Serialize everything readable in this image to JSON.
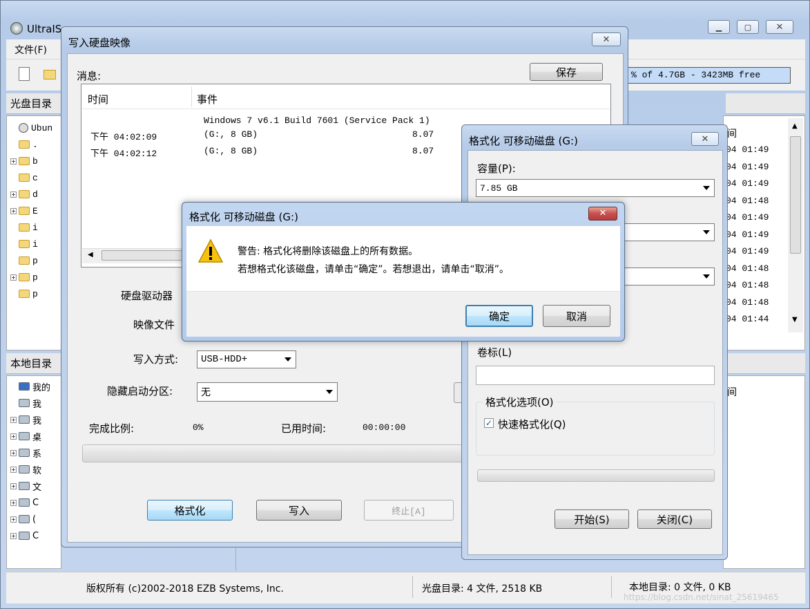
{
  "main": {
    "title": "UltraISO (试用版) - C:\\Users\\Administrator\\Desktop\\ubuntu-14.04.5-desktop-amd64.iso",
    "menu_file": "文件(F)",
    "free_space": "% of 4.7GB - 3423MB free",
    "cd_dir_label": "光盘目录",
    "local_dir_label": "本地目录",
    "cd_tree": [
      {
        "expander": "",
        "label": "Ubun"
      },
      {
        "expander": "",
        "label": "."
      },
      {
        "expander": "+",
        "label": "b"
      },
      {
        "expander": "",
        "label": "c"
      },
      {
        "expander": "+",
        "label": "d"
      },
      {
        "expander": "+",
        "label": "E"
      },
      {
        "expander": "",
        "label": "i"
      },
      {
        "expander": "",
        "label": "i"
      },
      {
        "expander": "",
        "label": "p"
      },
      {
        "expander": "+",
        "label": "p"
      },
      {
        "expander": "",
        "label": "p"
      }
    ],
    "local_tree": [
      {
        "expander": "",
        "label": "我的"
      },
      {
        "expander": "",
        "label": "我"
      },
      {
        "expander": "+",
        "label": "我"
      },
      {
        "expander": "+",
        "label": "桌"
      },
      {
        "expander": "+",
        "label": "系"
      },
      {
        "expander": "+",
        "label": "软"
      },
      {
        "expander": "+",
        "label": "文"
      },
      {
        "expander": "+",
        "label": "C"
      },
      {
        "expander": "+",
        "label": "("
      },
      {
        "expander": "+",
        "label": "C"
      }
    ],
    "right_header": "间",
    "right_times": [
      "04 01:49",
      "04 01:49",
      "04 01:49",
      "04 01:48",
      "04 01:49",
      "04 01:49",
      "04 01:49",
      "04 01:48",
      "04 01:48",
      "04 01:48",
      "04 01:44"
    ],
    "local_right_header": "间",
    "status_copyright": "版权所有 (c)2002-2018 EZB Systems, Inc.",
    "status_cd": "光盘目录: 4 文件, 2518 KB",
    "status_local": "本地目录: 0 文件, 0 KB",
    "watermark": "https://blog.csdn.net/sinat_25619465"
  },
  "write_dialog": {
    "title": "写入硬盘映像",
    "message_label": "消息:",
    "save_button": "保存",
    "columns": [
      "时间",
      "事件"
    ],
    "rows": [
      {
        "time": "",
        "event": "Windows 7 v6.1 Build 7601 (Service Pack 1)",
        "extra": ""
      },
      {
        "time": "下午 04:02:09",
        "event": "(G:, 8 GB)",
        "extra": "8.07"
      },
      {
        "time": "下午 04:02:12",
        "event": "(G:, 8 GB)",
        "extra": "8.07"
      }
    ],
    "drive_label": "硬盘驱动器",
    "image_label": "映像文件",
    "write_mode_label": "写入方式:",
    "write_mode_value": "USB-HDD+",
    "hide_boot_label": "隐藏启动分区:",
    "hide_boot_value": "无",
    "complete_label": "完成比例:",
    "complete_value": "0%",
    "elapsed_label": "已用时间:",
    "elapsed_value": "00:00:00",
    "progress": 0,
    "format_button": "格式化",
    "write_button": "写入",
    "stop_button": "终止[A]"
  },
  "format_dialog": {
    "title": "格式化 可移动磁盘 (G:)",
    "capacity_label": "容量(P):",
    "capacity_value": "7.85 GB",
    "volume_label": "卷标(L)",
    "volume_value": "",
    "options_legend": "格式化选项(O)",
    "quick_format": "快速格式化(Q)",
    "quick_format_checked": true,
    "start_button": "开始(S)",
    "close_button": "关闭(C)"
  },
  "warning_dialog": {
    "title": "格式化 可移动磁盘 (G:)",
    "line1": "警告: 格式化将删除该磁盘上的所有数据。",
    "line2": "若想格式化该磁盘，请单击“确定”。若想退出，请单击“取消”。",
    "ok_button": "确定",
    "cancel_button": "取消"
  },
  "colors": {
    "accent": "#3c7fb1",
    "close_red": "#c75050",
    "warning_yellow": "#f5c211"
  }
}
